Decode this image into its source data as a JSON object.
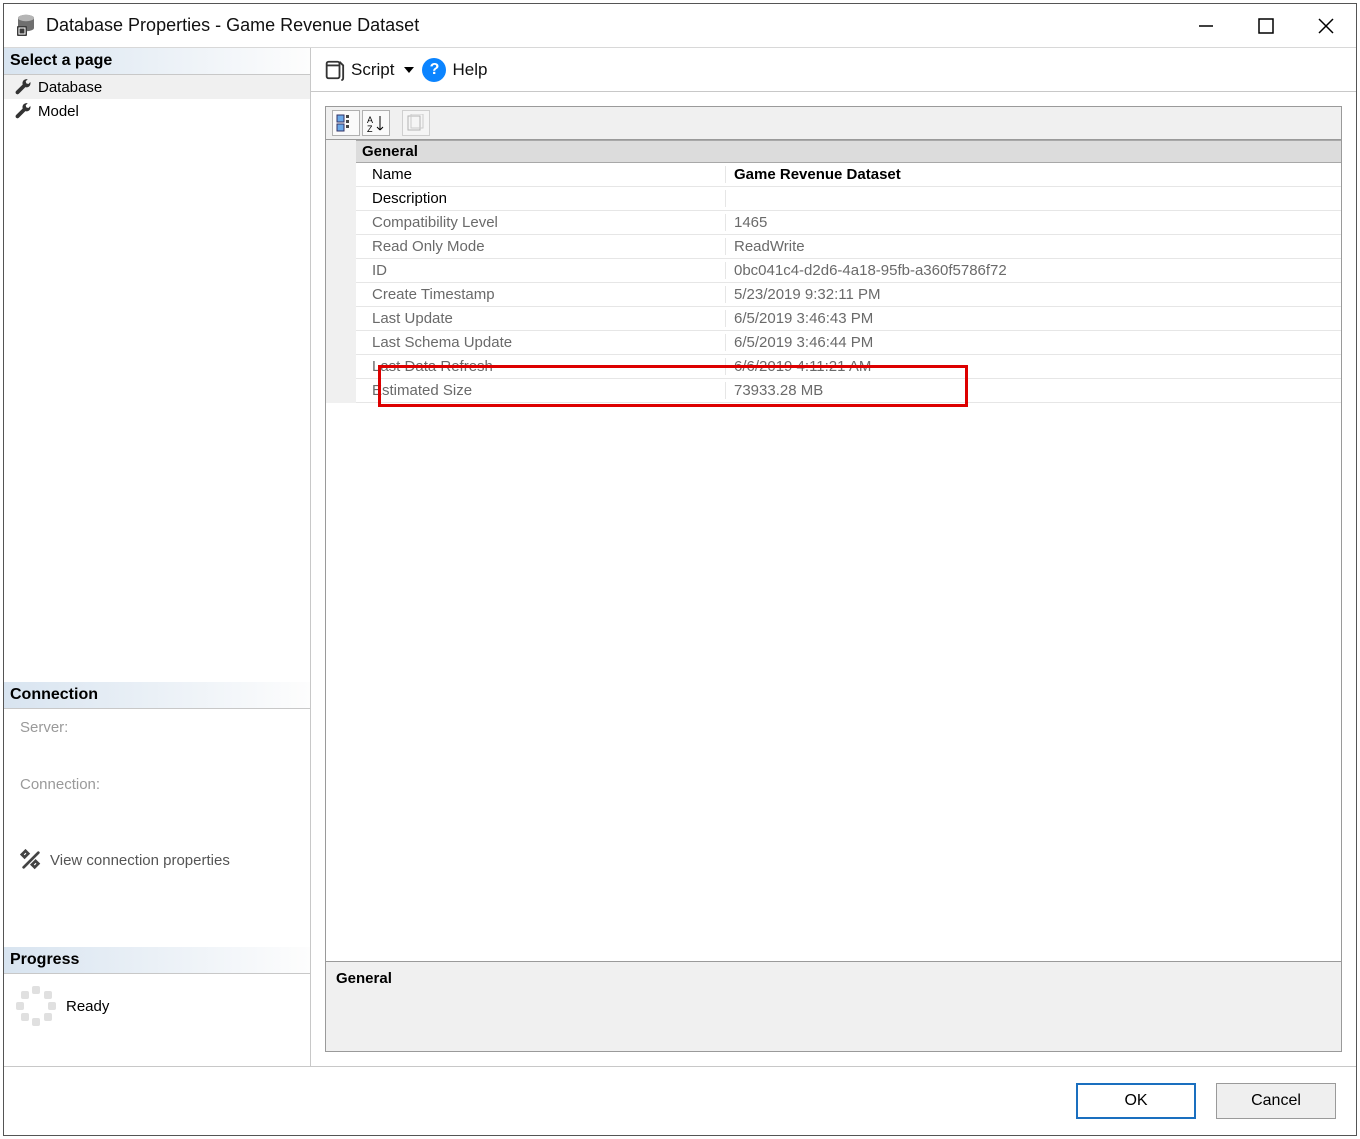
{
  "window": {
    "title": "Database Properties - Game Revenue Dataset"
  },
  "sidebar": {
    "select_page": "Select a page",
    "pages": [
      {
        "label": "Database"
      },
      {
        "label": "Model"
      }
    ],
    "connection_header": "Connection",
    "server_label": "Server:",
    "connection_label": "Connection:",
    "view_conn_props": "View connection properties",
    "progress_header": "Progress",
    "progress_status": "Ready"
  },
  "toolbar": {
    "script_label": "Script",
    "help_label": "Help"
  },
  "property_group": {
    "header": "General",
    "rows": [
      {
        "key": "Name",
        "value": "Game Revenue Dataset",
        "readonly": false,
        "bold_value": true
      },
      {
        "key": "Description",
        "value": "",
        "readonly": false,
        "bold_value": false
      },
      {
        "key": "Compatibility Level",
        "value": "1465",
        "readonly": true,
        "bold_value": false
      },
      {
        "key": "Read Only Mode",
        "value": "ReadWrite",
        "readonly": true,
        "bold_value": false
      },
      {
        "key": "ID",
        "value": "0bc041c4-d2d6-4a18-95fb-a360f5786f72",
        "readonly": true,
        "bold_value": false
      },
      {
        "key": "Create Timestamp",
        "value": "5/23/2019 9:32:11 PM",
        "readonly": true,
        "bold_value": false
      },
      {
        "key": "Last Update",
        "value": "6/5/2019 3:46:43 PM",
        "readonly": true,
        "bold_value": false
      },
      {
        "key": "Last Schema Update",
        "value": "6/5/2019 3:46:44 PM",
        "readonly": true,
        "bold_value": false
      },
      {
        "key": "Last Data Refresh",
        "value": "6/6/2019 4:11:21 AM",
        "readonly": true,
        "bold_value": false
      },
      {
        "key": "Estimated Size",
        "value": "73933.28 MB",
        "readonly": true,
        "bold_value": false,
        "highlighted": true
      }
    ]
  },
  "description_pane": {
    "label": "General"
  },
  "footer": {
    "ok": "OK",
    "cancel": "Cancel"
  }
}
